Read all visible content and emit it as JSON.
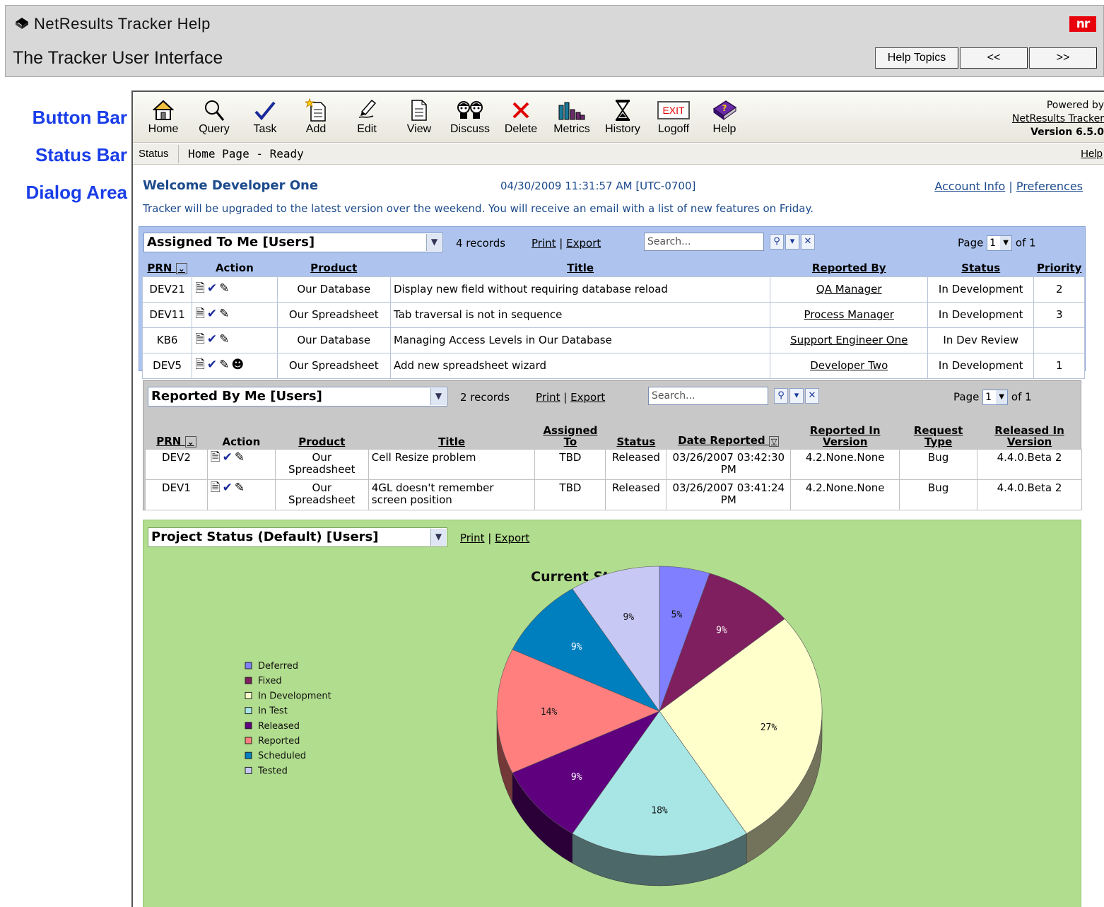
{
  "help": {
    "app_name": "NetResults Tracker Help",
    "logo_text": "nr",
    "topic": "The Tracker User Interface",
    "buttons": {
      "topics": "Help Topics",
      "prev": "<<",
      "next": ">>"
    }
  },
  "left_labels": {
    "button_bar": "Button Bar",
    "status_bar": "Status Bar",
    "dialog_area": "Dialog Area"
  },
  "toolbar": {
    "items": [
      {
        "label": "Home",
        "icon": "home-icon"
      },
      {
        "label": "Query",
        "icon": "magnifier-icon"
      },
      {
        "label": "Task",
        "icon": "checkmark-icon"
      },
      {
        "label": "Add",
        "icon": "add-document-icon"
      },
      {
        "label": "Edit",
        "icon": "pencil-icon"
      },
      {
        "label": "View",
        "icon": "document-icon"
      },
      {
        "label": "Discuss",
        "icon": "people-icon"
      },
      {
        "label": "Delete",
        "icon": "red-x-icon"
      },
      {
        "label": "Metrics",
        "icon": "bar-chart-icon"
      },
      {
        "label": "History",
        "icon": "hourglass-icon"
      },
      {
        "label": "Logoff",
        "icon": "exit-sign-icon"
      },
      {
        "label": "Help",
        "icon": "help-book-icon"
      }
    ],
    "exit_sign": "EXIT",
    "powered_by": "Powered by",
    "product": "NetResults Tracker",
    "version": "Version 6.5.0"
  },
  "status_bar": {
    "label": "Status",
    "text": "Home Page - Ready",
    "help": "Help"
  },
  "dialog": {
    "welcome": "Welcome Developer One",
    "datetime": "04/30/2009 11:31:57 AM [UTC-0700]",
    "account_info": "Account Info",
    "link_sep": "|",
    "preferences": "Preferences",
    "announcement": "Tracker will be upgraded to the latest version over the weekend. You will receive an email with a list of new features on Friday."
  },
  "assigned": {
    "query": "Assigned To Me [Users]",
    "records": "4 records",
    "print": "Print",
    "sep": "|",
    "export": "Export",
    "search_placeholder": "Search...",
    "page_label": "Page",
    "page_value": "1",
    "page_of": "of 1",
    "columns": [
      "PRN",
      "Action",
      "Product",
      "Title",
      "Reported By",
      "Status",
      "Priority"
    ],
    "rows": [
      {
        "prn": "DEV21",
        "product": "Our Database",
        "title": "Display new field without requiring database reload",
        "reported_by": "QA Manager",
        "status": "In Development",
        "priority": "2"
      },
      {
        "prn": "DEV11",
        "product": "Our Spreadsheet",
        "title": "Tab traversal is not in sequence",
        "reported_by": "Process Manager",
        "status": "In Development",
        "priority": "3"
      },
      {
        "prn": "KB6",
        "product": "Our Database",
        "title": "Managing Access Levels in Our Database",
        "reported_by": "Support Engineer One",
        "status": "In Dev Review",
        "priority": ""
      },
      {
        "prn": "DEV5",
        "product": "Our Spreadsheet",
        "title": "Add new spreadsheet wizard",
        "reported_by": "Developer Two",
        "status": "In Development",
        "priority": "1"
      }
    ]
  },
  "reported": {
    "query": "Reported By Me [Users]",
    "records": "2 records",
    "print": "Print",
    "sep": "|",
    "export": "Export",
    "search_placeholder": "Search...",
    "page_label": "Page",
    "page_value": "1",
    "page_of": "of 1",
    "columns": [
      "PRN",
      "Action",
      "Product",
      "Title",
      "Assigned To",
      "Status",
      "Date Reported",
      "Reported In Version",
      "Request Type",
      "Released In Version"
    ],
    "rows": [
      {
        "prn": "DEV2",
        "product": "Our Spreadsheet",
        "title": "Cell Resize problem",
        "assigned_to": "TBD",
        "status": "Released",
        "date": "03/26/2007 03:42:30 PM",
        "reported_in": "4.2.None.None",
        "type": "Bug",
        "released_in": "4.4.0.Beta 2"
      },
      {
        "prn": "DEV1",
        "product": "Our Spreadsheet",
        "title": "4GL doesn't remember screen position",
        "assigned_to": "TBD",
        "status": "Released",
        "date": "03/26/2007 03:41:24 PM",
        "reported_in": "4.2.None.None",
        "type": "Bug",
        "released_in": "4.4.0.Beta 2"
      }
    ]
  },
  "project": {
    "query": "Project Status (Default) [Users]",
    "print": "Print",
    "sep": "|",
    "export": "Export"
  },
  "chart_data": {
    "type": "pie",
    "title": "Current Status Totals",
    "legend_position": "left",
    "categories": [
      "Deferred",
      "Fixed",
      "In Development",
      "In Test",
      "Released",
      "Reported",
      "Scheduled",
      "Tested"
    ],
    "colors": [
      "#7f7fff",
      "#7f1f5f",
      "#ffffcc",
      "#a8e6e6",
      "#5f007f",
      "#ff7f7f",
      "#007fbf",
      "#c8c8f5"
    ],
    "slices_clockwise_from_top": [
      "Deferred",
      "Fixed",
      "In Development",
      "In Test",
      "Released",
      "Reported",
      "Scheduled",
      "Tested"
    ],
    "values": [
      5,
      9,
      27,
      18,
      9,
      14,
      9,
      9
    ],
    "labels": [
      "5%",
      "9%",
      "27%",
      "18%",
      "9%",
      "14%",
      "9%",
      "9%"
    ]
  }
}
